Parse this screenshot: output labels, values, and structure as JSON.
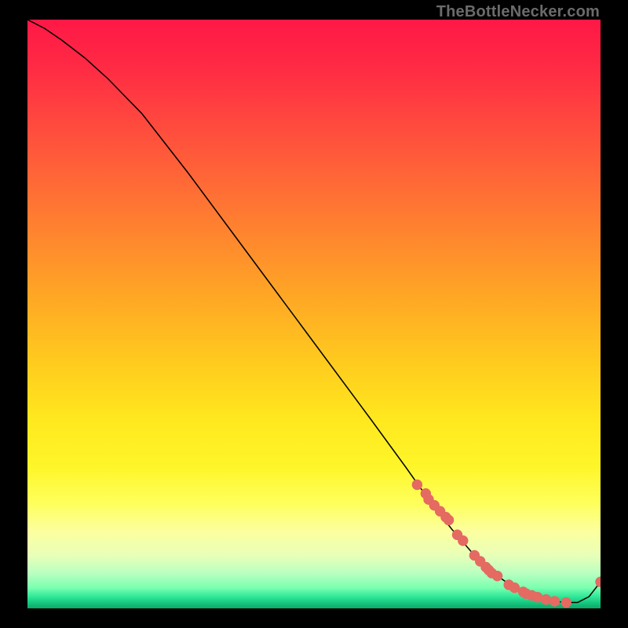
{
  "watermark": "TheBottleNecker.com",
  "colors": {
    "dot": "#e46a62",
    "curve": "#000000"
  },
  "chart_data": {
    "type": "line",
    "title": "",
    "xlabel": "",
    "ylabel": "",
    "xlim": [
      0,
      100
    ],
    "ylim": [
      0,
      100
    ],
    "grid": false,
    "series": [
      {
        "name": "bottleneck-curve",
        "x": [
          0,
          3,
          6,
          10,
          14,
          20,
          28,
          36,
          44,
          52,
          60,
          66,
          70,
          74,
          78,
          82,
          85,
          88,
          90,
          92,
          94,
          96,
          98,
          100
        ],
        "y": [
          100,
          98.5,
          96.5,
          93.5,
          90,
          84,
          74,
          63.5,
          53,
          42.5,
          32,
          24,
          18.5,
          13.5,
          9,
          5.5,
          3.5,
          2.2,
          1.6,
          1.2,
          1.0,
          1.0,
          2.0,
          4.5
        ]
      }
    ],
    "scatter": [
      {
        "name": "curve-markers",
        "x": [
          68,
          69.5,
          70,
          71,
          72,
          73,
          73.5,
          75,
          76,
          78,
          79,
          80,
          80.5,
          81,
          82,
          84,
          85,
          86.5,
          87,
          88,
          89,
          90.5,
          92,
          94,
          100
        ],
        "y": [
          21,
          19.5,
          18.5,
          17.5,
          16.5,
          15.5,
          15,
          12.5,
          11.5,
          9,
          8,
          7,
          6.5,
          6,
          5.5,
          4,
          3.5,
          2.8,
          2.5,
          2.2,
          1.9,
          1.5,
          1.2,
          1.0,
          4.5
        ]
      }
    ]
  }
}
